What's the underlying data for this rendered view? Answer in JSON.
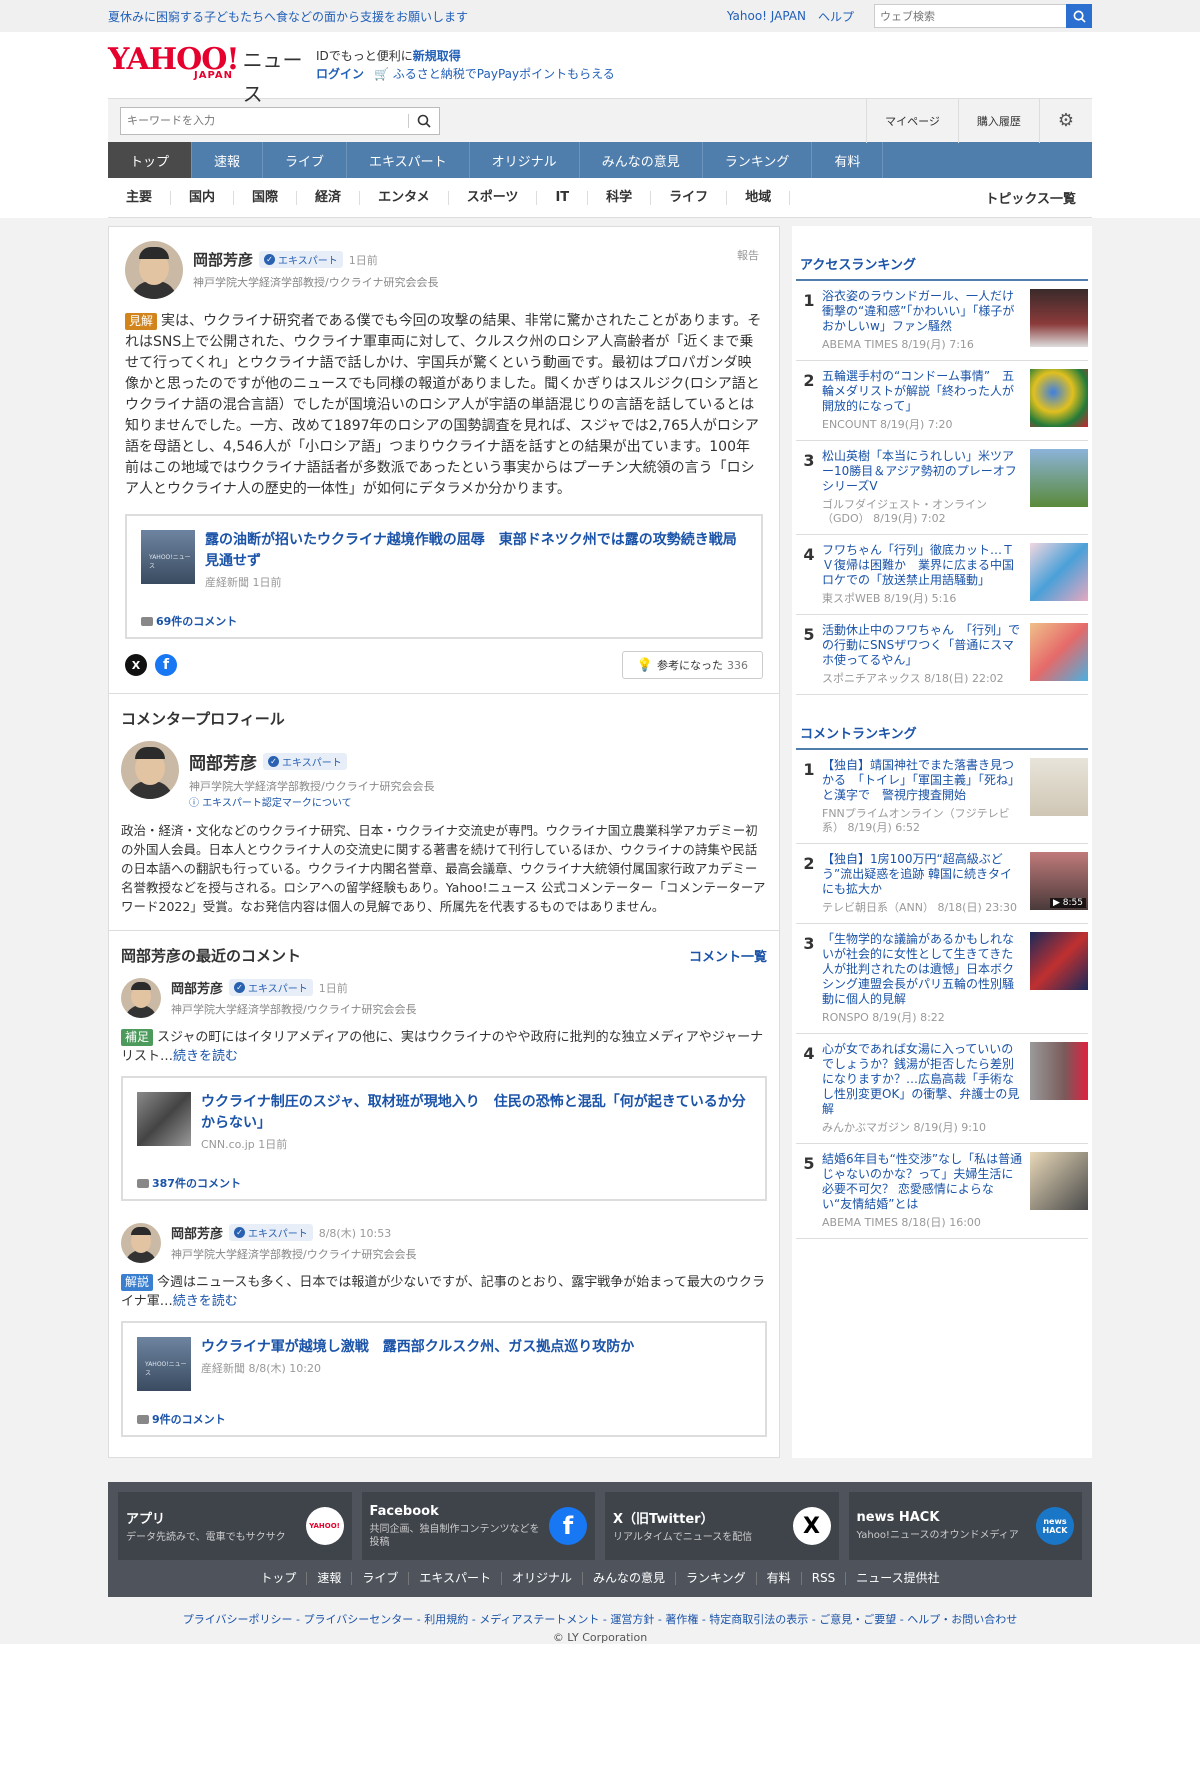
{
  "promo": {
    "text": "夏休みに困窮する子どもたちへ食などの面から支援をお願いします",
    "links": [
      "Yahoo! JAPAN",
      "ヘルプ"
    ],
    "search_placeholder": "ウェブ検索"
  },
  "header": {
    "logo_main": "YAHOO!",
    "logo_sub": "JAPAN",
    "logo_news": "ニュース",
    "id_text": "IDでもっと便利に",
    "id_link": "新規取得",
    "login": "ログイン",
    "furusato": "ふるさと納税でPayPayポイントもらえる"
  },
  "search": {
    "placeholder": "キーワードを入力",
    "mypage": "マイページ",
    "history": "購入履歴"
  },
  "nav": {
    "tabs": [
      "トップ",
      "速報",
      "ライブ",
      "エキスパート",
      "オリジナル",
      "みんなの意見",
      "ランキング",
      "有料"
    ],
    "categories": [
      "主要",
      "国内",
      "国際",
      "経済",
      "エンタメ",
      "スポーツ",
      "IT",
      "科学",
      "ライフ",
      "地域"
    ],
    "topics": "トピックス一覧"
  },
  "post": {
    "name": "岡部芳彦",
    "badge": "エキスパート",
    "ago": "1日前",
    "title": "神戸学院大学経済学部教授/ウクライナ研究会会長",
    "report": "報告",
    "label": "見解",
    "text": "実は、ウクライナ研究者である僕でも今回の攻撃の結果、非常に驚かされたことがあります。それはSNS上で公開された、ウクライナ軍車両に対して、クルスク州のロシア人高齢者が「近くまで乗せて行ってくれ」とウクライナ語で話しかけ、宇国兵が驚くという動画です。最初はプロパガンダ映像かと思ったのですが他のニュースでも同様の報道がありました。聞くかぎりはスルジク(ロシア語とウクライナ語の混合言語）でしたが国境沿いのロシア人が宇語の単語混じりの言語を話しているとは知りませんでした。一方、改めて1897年のロシアの国勢調査を見れば、スジャでは2,765人がロシア語を母語とし、4,546人が「小ロシア語」つまりウクライナ語を話すとの結果が出ています。100年前はこの地域ではウクライナ語話者が多数派であったという事実からはプーチン大統領の言う「ロシア人とウクライナ人の歴史的一体性」が如何にデタラメか分かります。",
    "article": {
      "thumb": "YAHOO!ニュース",
      "title": "露の油断が招いたウクライナ越境作戦の屈辱　東部ドネツク州では露の攻勢続き戦局見通せず",
      "source": "産経新聞 1日前",
      "comments": "69件のコメント"
    },
    "sns_x": "X",
    "sns_f": "f",
    "useful_label": "参考になった",
    "useful_count": "336"
  },
  "profile": {
    "heading": "コメンタープロフィール",
    "name": "岡部芳彦",
    "badge": "エキスパート",
    "title": "神戸学院大学経済学部教授/ウクライナ研究会会長",
    "link": "エキスパート認定マークについて",
    "text": "政治・経済・文化などのウクライナ研究、日本・ウクライナ交流史が専門。ウクライナ国立農業科学アカデミー初の外国人会員。日本人とウクライナ人の交流史に関する著書を続けて刊行しているほか、ウクライナの詩集や民話の日本語への翻訳も行っている。ウクライナ内閣名誉章、最高会議章、ウクライナ大統領付属国家行政アカデミー名誉教授などを授与される。ロシアへの留学経験もあり。Yahoo!ニュース 公式コメンテーター「コメンテーターアワード2022」受賞。なお発信内容は個人の見解であり、所属先を代表するものではありません。"
  },
  "recent": {
    "heading": "岡部芳彦の最近のコメント",
    "more": "コメント一覧",
    "items": [
      {
        "name": "岡部芳彦",
        "badge": "エキスパート",
        "ago": "1日前",
        "title": "神戸学院大学経済学部教授/ウクライナ研究会会長",
        "label": "補足",
        "text": "スジャの町にはイタリアメディアの他に、実はウクライナのやや政府に批判的な独立メディアやジャーナリスト…",
        "readmore": "続きを読む",
        "article_title": "ウクライナ制圧のスジャ、取材班が現地入り　住民の恐怖と混乱「何が起きているか分からない」",
        "article_source": "CNN.co.jp 1日前",
        "comments": "387件のコメント"
      },
      {
        "name": "岡部芳彦",
        "badge": "エキスパート",
        "ago": "8/8(木) 10:53",
        "title": "神戸学院大学経済学部教授/ウクライナ研究会会長",
        "label": "解説",
        "text": "今週はニュースも多く、日本では報道が少ないですが、記事のとおり、露宇戦争が始まって最大のウクライナ軍…",
        "readmore": "続きを読む",
        "article_thumb": "YAHOO!ニュース",
        "article_title": "ウクライナ軍が越境し激戦　露西部クルスク州、ガス拠点巡り攻防か",
        "article_source": "産経新聞 8/8(木) 10:20",
        "comments": "9件のコメント"
      }
    ]
  },
  "access_ranking": {
    "heading": "アクセスランキング",
    "items": [
      {
        "no": "1",
        "title": "浴衣姿のラウンドガール、一人だけ衝撃の“違和感”「かわいい」「様子がおかしいw」ファン騒然",
        "source": "ABEMA TIMES 8/19(月) 7:16"
      },
      {
        "no": "2",
        "title": "五輪選手村の“コンドーム事情”　五輪メダリストが解説「終わった人が開放的になって」",
        "source": "ENCOUNT 8/19(月) 7:20"
      },
      {
        "no": "3",
        "title": "松山英樹「本当にうれしい」米ツアー10勝目＆アジア勢初のプレーオフシリーズV",
        "source": "ゴルフダイジェスト・オンライン（GDO） 8/19(月) 7:02"
      },
      {
        "no": "4",
        "title": "フワちゃん「行列」徹底カット…ＴＶ復帰は困難か　業界に広まる中国ロケでの「放送禁止用語騒動」",
        "source": "東スポWEB 8/19(月) 5:16"
      },
      {
        "no": "5",
        "title": "活動休止中のフワちゃん　「行列」での行動にSNSザワつく「普通にスマホ使ってるやん」",
        "source": "スポニチアネックス 8/18(日) 22:02"
      }
    ]
  },
  "comment_ranking": {
    "heading": "コメントランキング",
    "items": [
      {
        "no": "1",
        "title": "【独自】靖国神社でまた落書き見つかる　「トイレ」「軍国主義」「死ね」と漢字で　警視庁捜査開始",
        "source": "FNNプライムオンライン（フジテレビ系） 8/19(月) 6:52"
      },
      {
        "no": "2",
        "title": "【独自】1房100万円“超高級ぶどう”流出疑惑を追跡 韓国に続きタイにも拡大か",
        "source": "テレビ朝日系（ANN） 8/18(日) 23:30",
        "duration": "▶ 8:55"
      },
      {
        "no": "3",
        "title": "「生物学的な議論があるかもしれないが社会的に女性として生きてきた人が批判されたのは遺憾」日本ボクシング連盟会長がパリ五輪の性別騒動に個人的見解",
        "source": "RONSPO 8/19(月) 8:22"
      },
      {
        "no": "4",
        "title": "心が女であれば女湯に入っていいのでしょうか？銭湯が拒否したら差別になりますか？…広島高裁「手術なし性別変更OK」の衝撃、弁護士の見解",
        "source": "みんかぶマガジン 8/19(月) 9:10"
      },
      {
        "no": "5",
        "title": "結婚6年目も“性交渉”なし「私は普通じゃないのかな？って」夫婦生活に必要不可欠？ 恋愛感情によらない“友情結婚”とは",
        "source": "ABEMA TIMES 8/18(日) 16:00"
      }
    ]
  },
  "footer": {
    "cards": [
      {
        "title": "アプリ",
        "desc": "データ先読みで、電車でもサクサク",
        "icon": "YAHOO!"
      },
      {
        "title": "Facebook",
        "desc": "共同企画、独自制作コンテンツなどを投稿",
        "icon": "f"
      },
      {
        "title": "X（旧Twitter）",
        "desc": "リアルタイムでニュースを配信",
        "icon": "X"
      },
      {
        "title": "news HACK",
        "desc": "Yahoo!ニュースのオウンドメディア",
        "icon": "news HACK"
      }
    ],
    "links": [
      "トップ",
      "速報",
      "ライブ",
      "エキスパート",
      "オリジナル",
      "みんなの意見",
      "ランキング",
      "有料",
      "RSS",
      "ニュース提供社"
    ],
    "legal": "プライバシーポリシー - プライバシーセンター - 利用規約 - メディアステートメント - 運営方針 - 著作権 - 特定商取引法の表示 - ご意見・ご要望 - ヘルプ・お問い合わせ",
    "copyright": "© LY Corporation"
  }
}
